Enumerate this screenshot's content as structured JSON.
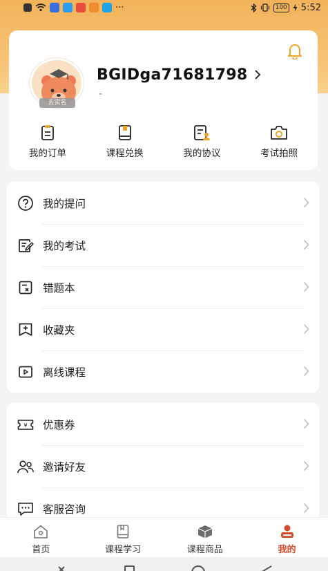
{
  "status_bar": {
    "time": "5:52",
    "battery": "100",
    "left_icons": [
      "notification-icon",
      "wifi-icon",
      "app-icon",
      "app-icon",
      "app-icon",
      "app-icon",
      "app-icon"
    ],
    "overflow": "···"
  },
  "profile": {
    "username": "BGIDga71681798",
    "subtitle": "-",
    "verify_tag": "去实名"
  },
  "quick_actions": [
    {
      "label": "我的订单",
      "icon": "order-icon"
    },
    {
      "label": "课程兑换",
      "icon": "book-icon"
    },
    {
      "label": "我的协议",
      "icon": "agreement-icon"
    },
    {
      "label": "考试拍照",
      "icon": "camera-icon"
    }
  ],
  "menu_group_1": [
    {
      "label": "我的提问",
      "icon": "question-icon"
    },
    {
      "label": "我的考试",
      "icon": "exam-icon"
    },
    {
      "label": "错题本",
      "icon": "wrong-book-icon"
    },
    {
      "label": "收藏夹",
      "icon": "favorites-icon"
    },
    {
      "label": "离线课程",
      "icon": "offline-video-icon"
    }
  ],
  "menu_group_2": [
    {
      "label": "优惠券",
      "icon": "coupon-icon"
    },
    {
      "label": "邀请好友",
      "icon": "invite-icon"
    },
    {
      "label": "客服咨询",
      "icon": "chat-icon"
    }
  ],
  "bottom_nav": [
    {
      "label": "首页",
      "icon": "home-icon",
      "active": false
    },
    {
      "label": "课程学习",
      "icon": "study-icon",
      "active": false
    },
    {
      "label": "课程商品",
      "icon": "box-icon",
      "active": false
    },
    {
      "label": "我的",
      "icon": "profile-icon",
      "active": true
    }
  ],
  "colors": {
    "header_gradient_top": "#f2b35a",
    "accent": "#d44a2a",
    "bell": "#f0a52a"
  }
}
